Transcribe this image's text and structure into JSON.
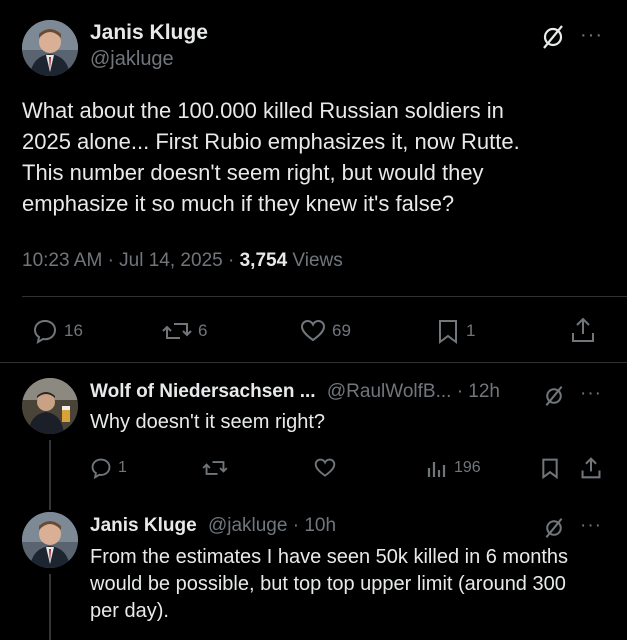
{
  "main_post": {
    "author_name": "Janis Kluge",
    "author_handle": "@jakluge",
    "text_lines": [
      "What about the 100.000 killed Russian soldiers in",
      "2025 alone... First Rubio emphasizes it, now Rutte.",
      "This number doesn't seem right, but would they",
      "emphasize it so much if they knew it's false?"
    ],
    "time": "10:23 AM",
    "sep1": "·",
    "date": "Jul 14, 2025",
    "sep2": "·",
    "views_count": "3,754",
    "views_label": "Views",
    "replies": "16",
    "reposts": "6",
    "likes": "69",
    "bookmarks": "1",
    "more": "···"
  },
  "reply1": {
    "author_name": "Wolf of Niedersachsen ...",
    "author_handle": "@RaulWolfB...",
    "sep": "·",
    "age": "12h",
    "text": "Why doesn't it seem right?",
    "replies": "1",
    "views": "196",
    "more": "···"
  },
  "reply2": {
    "author_name": "Janis Kluge",
    "author_handle": "@jakluge",
    "sep": "·",
    "age": "10h",
    "text_lines": [
      "From the estimates I have seen 50k killed in 6 months",
      "would be possible, but top top upper limit (around 300",
      "per day)."
    ],
    "more": "···"
  },
  "icons": {
    "grok": "grok-icon",
    "more": "more-icon",
    "reply": "reply-icon",
    "repost": "repost-icon",
    "like": "like-icon",
    "bookmark": "bookmark-icon",
    "share": "share-icon",
    "views": "views-icon"
  }
}
